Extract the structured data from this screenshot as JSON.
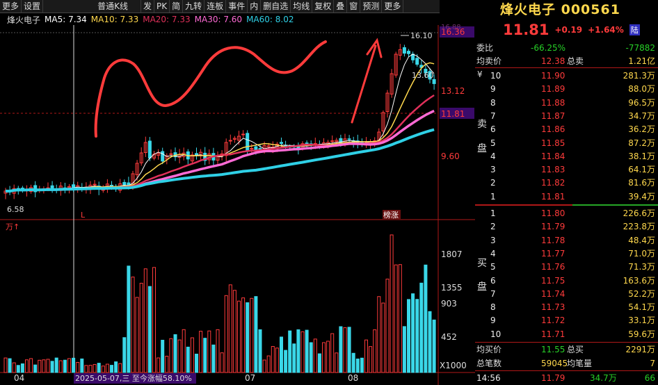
{
  "toolbar": {
    "items": [
      "更多",
      "设置",
      "普通K线",
      "发",
      "PK",
      "简",
      "九转",
      "连板",
      "事件",
      "内",
      "删自选",
      "均线",
      "复权",
      "叠",
      "窗",
      "预测",
      "更多"
    ]
  },
  "stock": {
    "name": "烽火电子",
    "code": "000561",
    "name_code": "烽火电子 000561",
    "price": "11.81",
    "change": "+0.19",
    "change_pct": "+1.64%",
    "market_tag": "陆"
  },
  "ma": {
    "name": "烽火电子",
    "ma5": "MA5: 7.34",
    "ma10": "MA10: 7.33",
    "ma20": "MA20: 7.33",
    "ma30": "MA30: 7.60",
    "ma60": "MA60: 8.02"
  },
  "price_axis": {
    "top": "16.36",
    "high": "16.10",
    "p13_60": "13.60",
    "p13_12": "13.12",
    "current": "11.81",
    "p9_60": "9.60",
    "low": "6.58",
    "top_dim": "16.88"
  },
  "markers": {
    "L": "L",
    "bangzhang": "榜涨"
  },
  "volume": {
    "unit": "万↑",
    "axis": [
      "1807",
      "1355",
      "903",
      "452",
      "X1000"
    ]
  },
  "dates": {
    "d04": "04",
    "d07": "07",
    "d08": "08",
    "highlight": "2025-05-07,三 至今涨幅58.10%"
  },
  "order_book": {
    "webi": {
      "label": "委比",
      "pct": "-66.25%",
      "diff": "-77882"
    },
    "avg_sell": {
      "label": "均卖价",
      "value": "12.38",
      "total_label": "总卖",
      "total": "1.21亿"
    },
    "sell_label_1": "卖",
    "sell_label_2": "盘",
    "yen": "¥",
    "sells": [
      {
        "lvl": "10",
        "price": "11.90",
        "vol": "281.3万"
      },
      {
        "lvl": "9",
        "price": "11.89",
        "vol": "88.0万"
      },
      {
        "lvl": "8",
        "price": "11.88",
        "vol": "96.5万"
      },
      {
        "lvl": "7",
        "price": "11.87",
        "vol": "34.7万"
      },
      {
        "lvl": "6",
        "price": "11.86",
        "vol": "36.2万"
      },
      {
        "lvl": "5",
        "price": "11.85",
        "vol": "87.2万"
      },
      {
        "lvl": "4",
        "price": "11.84",
        "vol": "38.1万"
      },
      {
        "lvl": "3",
        "price": "11.83",
        "vol": "64.1万"
      },
      {
        "lvl": "2",
        "price": "11.82",
        "vol": "81.6万"
      },
      {
        "lvl": "1",
        "price": "11.81",
        "vol": "39.4万"
      }
    ],
    "buy_label_1": "买",
    "buy_label_2": "盘",
    "buys": [
      {
        "lvl": "1",
        "price": "11.80",
        "vol": "226.6万"
      },
      {
        "lvl": "2",
        "price": "11.79",
        "vol": "223.8万"
      },
      {
        "lvl": "3",
        "price": "11.78",
        "vol": "48.4万"
      },
      {
        "lvl": "4",
        "price": "11.77",
        "vol": "71.0万"
      },
      {
        "lvl": "5",
        "price": "11.76",
        "vol": "71.3万"
      },
      {
        "lvl": "6",
        "price": "11.75",
        "vol": "163.6万"
      },
      {
        "lvl": "7",
        "price": "11.74",
        "vol": "52.2万"
      },
      {
        "lvl": "8",
        "price": "11.73",
        "vol": "54.1万"
      },
      {
        "lvl": "9",
        "price": "11.72",
        "vol": "33.1万"
      },
      {
        "lvl": "10",
        "price": "11.71",
        "vol": "59.6万"
      }
    ],
    "avg_buy": {
      "label": "均买价",
      "value": "11.55",
      "total_label": "总买",
      "total": "2291万"
    },
    "deals": {
      "label": "总笔数",
      "value": "59045",
      "avg_label": "均笔量",
      "avg": "7"
    },
    "tick": {
      "time": "14:56",
      "price": "11.79",
      "vol": "34.7万",
      "count": "66"
    }
  },
  "colors": {
    "up": "#ff3b3b",
    "down": "#3ad7e8",
    "ma5": "#ffffff",
    "ma10": "#ffd84d",
    "ma20": "#e0305a",
    "ma30": "#ff6ad5",
    "ma60": "#2fd0e6"
  }
}
